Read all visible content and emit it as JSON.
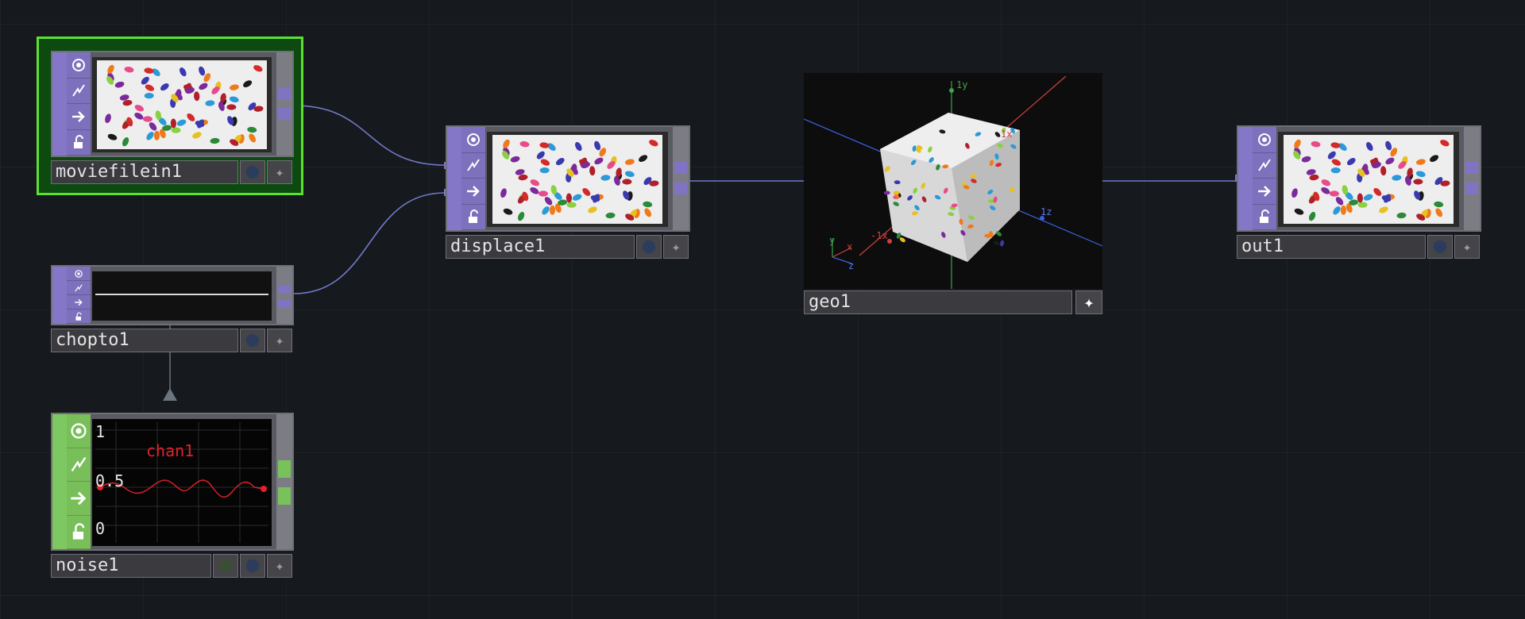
{
  "nodes": {
    "moviefilein1": {
      "name": "moviefilein1"
    },
    "chopto1": {
      "name": "chopto1"
    },
    "noise1": {
      "name": "noise1",
      "channel": "chan1",
      "axis": [
        "1",
        "0.5",
        "0"
      ]
    },
    "displace1": {
      "name": "displace1"
    },
    "geo1": {
      "name": "geo1",
      "axes": {
        "y": "1y",
        "x": "1x",
        "z": "1z",
        "negx": "-1x",
        "gy": "y",
        "gx": "x",
        "gz": "z"
      }
    },
    "out1": {
      "name": "out1"
    }
  },
  "colors": {
    "background": "#16191d",
    "top_family": "#8577c7",
    "chop_family": "#7ec861",
    "selected": "#5ee02e",
    "wire": "#6f79c8"
  },
  "icons": [
    "viewer-toggle-icon",
    "cook-icon",
    "bypass-arrow-icon",
    "lock-icon",
    "display-flag-icon",
    "render-star-icon"
  ]
}
